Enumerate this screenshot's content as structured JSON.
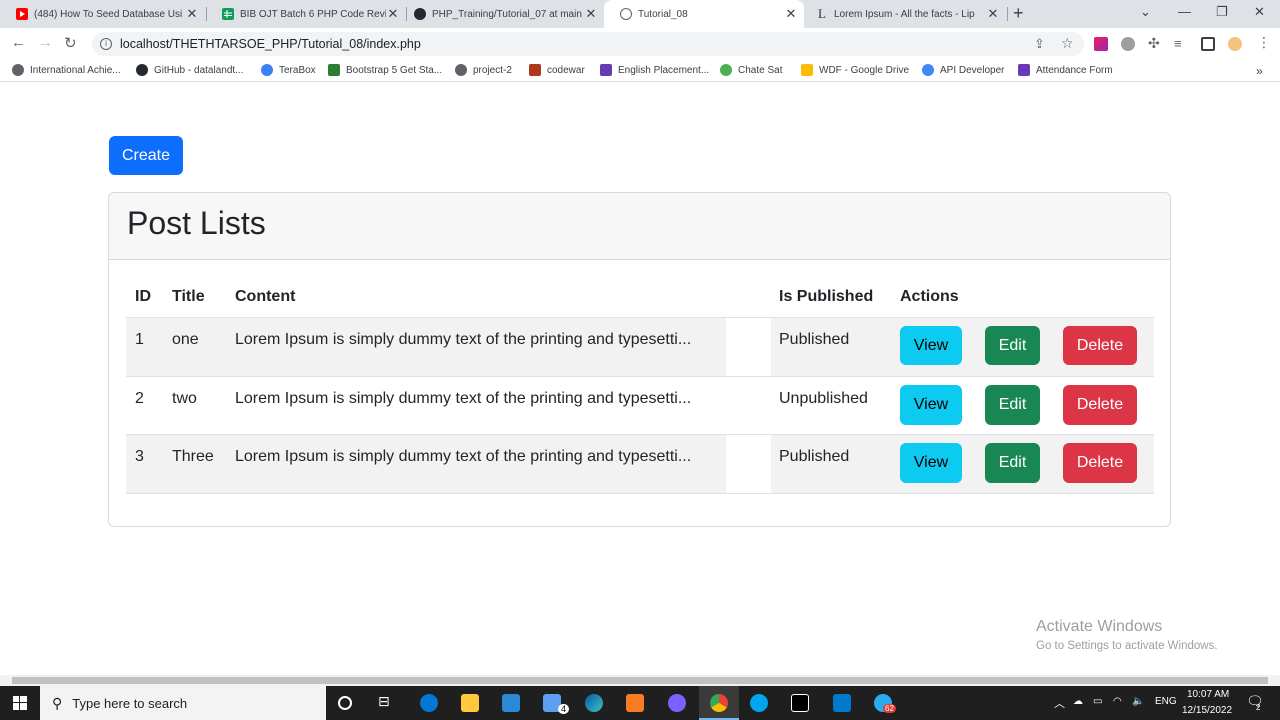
{
  "browser": {
    "tabs": [
      {
        "title": "(484) How To Seed Database Usi",
        "color": "#ff0000"
      },
      {
        "title": "BIB OJT Batch 6 PHP Code Revie",
        "color": "#0f9d58"
      },
      {
        "title": "PHP_Training/Tutorial_07 at main",
        "color": "#24292f"
      },
      {
        "title": "Tutorial_08",
        "color": "#5f6368"
      },
      {
        "title": "Lorem Ipsum - All the facts - Lip",
        "color": "#333333"
      }
    ],
    "new_tab": "+",
    "address": "localhost/THETHTARSOE_PHP/Tutorial_08/index.php",
    "bookmarks": [
      {
        "label": "International Achie...",
        "color": "#5f6368"
      },
      {
        "label": "GitHub - datalandt...",
        "color": "#24292f"
      },
      {
        "label": "TeraBox",
        "color": "#3b82f6"
      },
      {
        "label": "Bootstrap 5 Get Sta...",
        "color": "#2d7d32"
      },
      {
        "label": "project-2",
        "color": "#5f6368"
      },
      {
        "label": "codewar",
        "color": "#b1361e"
      },
      {
        "label": "English Placement...",
        "color": "#673ab7"
      },
      {
        "label": "Chate Sat",
        "color": "#4caf50"
      },
      {
        "label": "WDF - Google Drive",
        "color": "#fbbc04"
      },
      {
        "label": "API Developer",
        "color": "#4285f4"
      },
      {
        "label": "Attendance Form",
        "color": "#673ab7"
      }
    ],
    "more_bookmarks": "»"
  },
  "page": {
    "create_label": "Create",
    "card_title": "Post Lists",
    "columns": [
      "ID",
      "Title",
      "Content",
      "Is Published",
      "Actions"
    ],
    "rows": [
      {
        "id": "1",
        "title": "one",
        "content": "Lorem Ipsum is simply dummy text of the printing and typesetti...",
        "status": "Published"
      },
      {
        "id": "2",
        "title": "two",
        "content": "Lorem Ipsum is simply dummy text of the printing and typesetti...",
        "status": "Unpublished"
      },
      {
        "id": "3",
        "title": "Three",
        "content": "Lorem Ipsum is simply dummy text of the printing and typesetti...",
        "status": "Published"
      }
    ],
    "actions": {
      "view": "View",
      "edit": "Edit",
      "delete": "Delete"
    },
    "colors": {
      "primary": "#0d6efd",
      "info": "#0dcaf0",
      "success": "#198754",
      "danger": "#dc3545"
    }
  },
  "watermark": {
    "title": "Activate Windows",
    "subtitle": "Go to Settings to activate Windows."
  },
  "taskbar": {
    "search_placeholder": "Type here to search",
    "lang": "ENG",
    "time": "10:07 AM",
    "date": "12/15/2022",
    "edge_badge": "4",
    "telegram_badge": "62",
    "notif_count": "2"
  }
}
